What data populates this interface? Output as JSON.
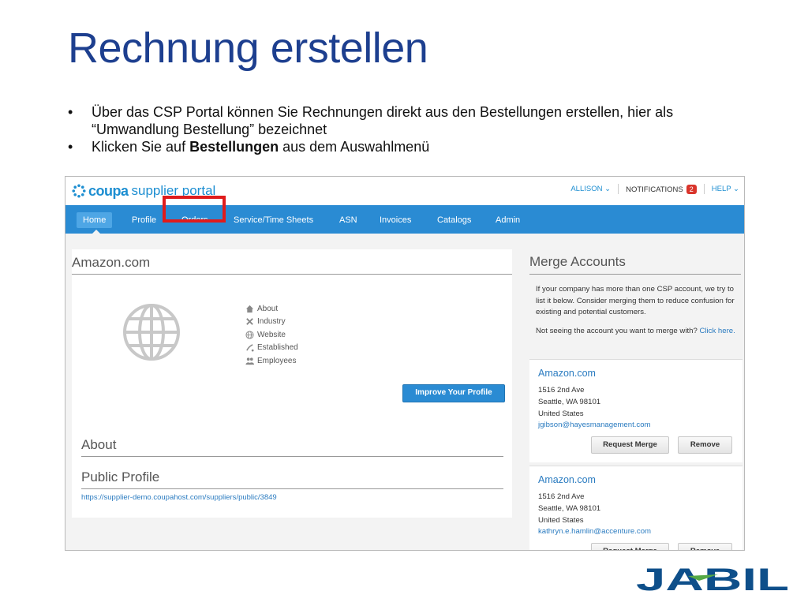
{
  "slide": {
    "title": "Rechnung erstellen",
    "bullets": [
      {
        "text": "Über das CSP Portal können Sie Rechnungen direkt aus den Bestellungen erstellen, hier als “Umwandlung Bestellung” bezeichnet"
      },
      {
        "prefix": "Klicken Sie auf ",
        "bold": "Bestellungen",
        "suffix": " aus dem Auswahlmenü"
      }
    ]
  },
  "portal": {
    "logo": {
      "brand": "coupa",
      "product": "supplier portal"
    },
    "top_nav": {
      "user": "ALLISON ⌄",
      "notifications": "NOTIFICATIONS",
      "notification_count": "2",
      "help": "HELP ⌄"
    },
    "nav": [
      "Home",
      "Profile",
      "Orders",
      "Service/Time Sheets",
      "ASN",
      "Invoices",
      "Catalogs",
      "Admin"
    ],
    "active_nav": "Home",
    "highlighted_nav": "Orders",
    "colors": {
      "nav_blue": "#2a8bd3",
      "highlight_red": "#e01b1b",
      "title_blue": "#1d3f8f"
    }
  },
  "company": {
    "name": "Amazon.com",
    "info": [
      {
        "icon": "home-icon",
        "label": "About"
      },
      {
        "icon": "wrench-icon",
        "label": "Industry"
      },
      {
        "icon": "globe-small-icon",
        "label": "Website"
      },
      {
        "icon": "calendar-icon",
        "label": "Established"
      },
      {
        "icon": "people-icon",
        "label": "Employees"
      }
    ],
    "improve_button": "Improve Your Profile",
    "about_title": "About",
    "public_profile_title": "Public Profile",
    "public_profile_url": "https://supplier-demo.coupahost.com/suppliers/public/3849"
  },
  "merge": {
    "title": "Merge Accounts",
    "intro": "If your company has more than one CSP account, we try to list it below. Consider merging them to reduce confusion for existing and potential customers.",
    "not_seeing": "Not seeing the account you want to merge with? ",
    "click_here": "Click here.",
    "accounts": [
      {
        "name": "Amazon.com",
        "street": "1516 2nd Ave",
        "city": "Seattle, WA  98101",
        "country": "United States",
        "email": "jgibson@hayesmanagement.com"
      },
      {
        "name": "Amazon.com",
        "street": "1516 2nd Ave",
        "city": "Seattle, WA  98101",
        "country": "United States",
        "email": "kathryn.e.hamlin@accenture.com"
      }
    ],
    "request_merge": "Request Merge",
    "remove": "Remove"
  },
  "footer_logo": "JABIL"
}
